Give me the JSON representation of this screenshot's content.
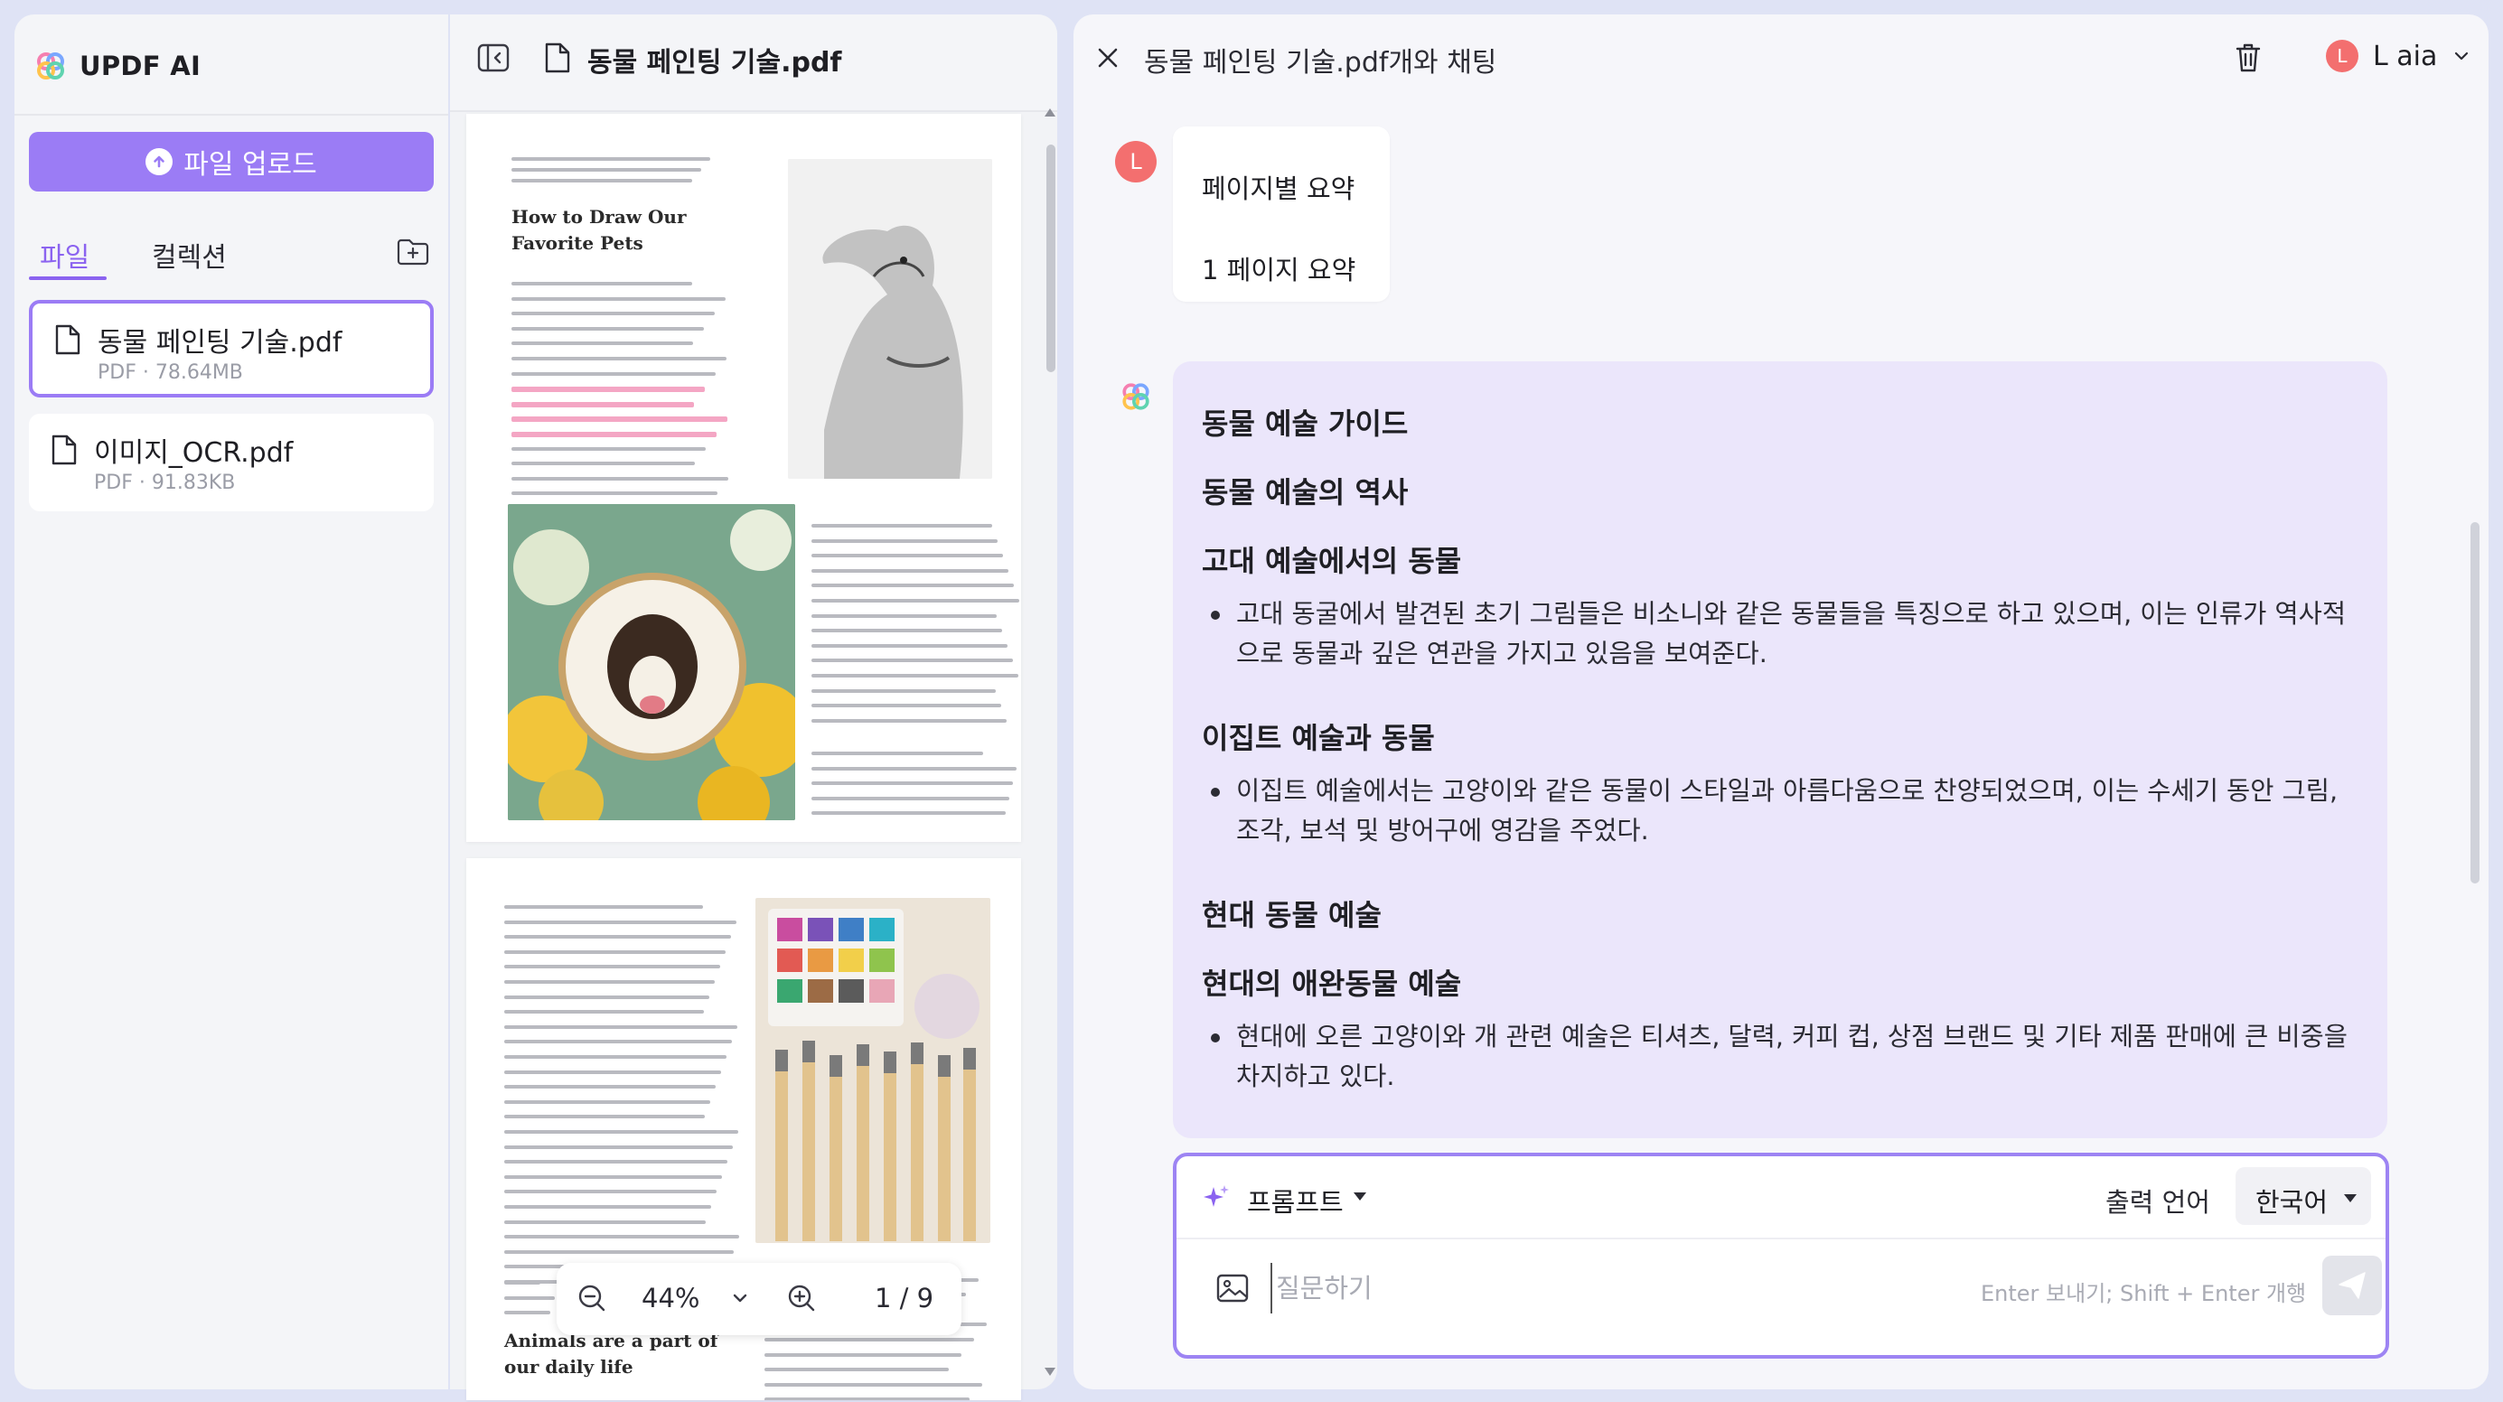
{
  "app": {
    "name": "UPDF AI"
  },
  "sidebar": {
    "upload_label": "파일 업로드",
    "tabs": [
      {
        "label": "파일",
        "active": true
      },
      {
        "label": "컬렉션",
        "active": false
      }
    ],
    "files": [
      {
        "name": "동물 페인팅 기술.pdf",
        "meta": "PDF · 78.64MB",
        "selected": true
      },
      {
        "name": "이미지_OCR.pdf",
        "meta": "PDF · 91.83KB",
        "selected": false
      }
    ]
  },
  "viewer": {
    "title": "동물 페인팅 기술.pdf",
    "page1_heading": "How to Draw Our Favorite Pets",
    "page2_heading": "Animals are a part of our daily life",
    "zoom": "44%",
    "page_indicator": "1 / 9"
  },
  "chat": {
    "title": "동물 페인팅 기술.pdf개와 채팅",
    "user": {
      "initial": "L",
      "name": "L aia"
    },
    "user_message": {
      "line1": "페이지별 요약",
      "line2": "1 페이지 요약"
    },
    "ai_message": {
      "h1": "동물 예술 가이드",
      "h2": "동물 예술의 역사",
      "h3": "고대 예술에서의 동물",
      "b1": "고대 동굴에서 발견된 초기 그림들은 비소니와 같은 동물들을 특징으로 하고 있으며, 이는 인류가 역사적으로 동물과 깊은 연관을 가지고 있음을 보여준다.",
      "h4": "이집트 예술과 동물",
      "b2": "이집트 예술에서는 고양이와 같은 동물이 스타일과 아름다움으로 찬양되었으며, 이는 수세기 동안 그림, 조각, 보석 및 방어구에 영감을 주었다.",
      "h5": "현대 동물 예술",
      "h6": "현대의 애완동물 예술",
      "b3": "현대에 오른 고양이와 개 관련 예술은 티셔츠, 달력, 커피 컵, 상점 브랜드 및 기타 제품 판매에 큰 비중을 차지하고 있다."
    },
    "composer": {
      "prompt_label": "프롬프트",
      "output_lang_label": "출력 언어",
      "output_lang_value": "한국어",
      "placeholder": "질문하기",
      "hint": "Enter 보내기; Shift + Enter 개행"
    }
  },
  "colors": {
    "accent": "#9b7cf5",
    "ai_bubble": "#ebe6fb",
    "highlight": "#f4a6c4"
  }
}
